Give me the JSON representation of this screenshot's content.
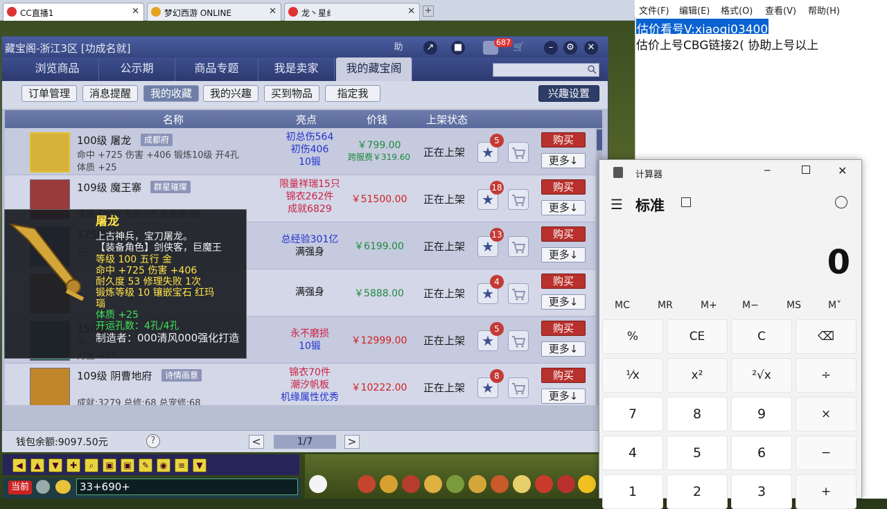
{
  "browser": {
    "tabs": [
      {
        "label": "CC直播1",
        "close": "✕"
      },
      {
        "label": "梦幻西游 ONLINE",
        "close": "✕"
      },
      {
        "label": "龙丶星纟",
        "close": "✕"
      }
    ],
    "new_tab": "+"
  },
  "cbg": {
    "title": "藏宝阁-浙江3区 [功成名就]",
    "title_buttons": {
      "help": "助",
      "share": "↗",
      "stop": "■",
      "msg_count": "687",
      "cart": "🛒",
      "minimize": "–",
      "settings": "⚙",
      "close": "✕"
    },
    "nav_tabs": [
      "浏览商品",
      "公示期",
      "商品专题",
      "我是卖家",
      "我的藏宝阁"
    ],
    "sub_buttons": [
      "订单管理",
      "消息提醒",
      "我的收藏",
      "我的兴趣",
      "买到物品",
      "指定我"
    ],
    "interest_settings": "兴趣设置",
    "columns": {
      "name": "名称",
      "highlight": "亮点",
      "price": "价钱",
      "status": "上架状态"
    },
    "rows": [
      {
        "level_name": "100级  屠龙",
        "server": "成都府",
        "stats1": "命中 +725  伤害 +406  锻炼10级  开4孔",
        "stats2": "体质 +25",
        "hl": [
          "初总伤564",
          "初伤406",
          "10锻"
        ],
        "hl_colors": [
          "#2233cc",
          "#2233cc",
          "#2233cc"
        ],
        "price": "￥799.00",
        "price2": "跨服费￥319.60",
        "price_color": "#1f8a3a",
        "status": "正在上架",
        "fav": "5",
        "buy": "购买",
        "more": "更多↓"
      },
      {
        "level_name": "109级  魔王寨",
        "server": "群星璀璨",
        "stats1": "",
        "stats2": "成就:6829  总修:68  总宠修:68",
        "hl": [
          "限量祥瑞15只",
          "锦衣262件",
          "成就6829"
        ],
        "hl_colors": [
          "#cc2244",
          "#cc2244",
          "#cc2244"
        ],
        "price": "￥51500.00",
        "price2": "",
        "price_color": "#d01f1f",
        "status": "正在上架",
        "fav": "18",
        "buy": "购买",
        "more": "更多↓"
      },
      {
        "level_name": "175级",
        "server": "",
        "stats1": "已",
        "stats2": "",
        "hl": [
          "总经验301亿",
          "满强身"
        ],
        "hl_colors": [
          "#2233cc",
          "#111111"
        ],
        "price": "￥6199.00",
        "price2": "",
        "price_color": "#1f8a3a",
        "status": "正在上架",
        "fav": "13",
        "buy": "购买",
        "more": "更多↓"
      },
      {
        "level_name": "",
        "server": "",
        "stats1": "",
        "stats2": "",
        "hl": [
          "满强身"
        ],
        "hl_colors": [
          "#111111"
        ],
        "price": "￥5888.00",
        "price2": "",
        "price_color": "#1f8a3a",
        "status": "正在上架",
        "fav": "4",
        "buy": "购买",
        "more": "更多↓"
      },
      {
        "level_name": "150级",
        "server": "",
        "stats1": "伤",
        "stats2": "力量 +18",
        "hl": [
          "永不磨损",
          "10锻"
        ],
        "hl_colors": [
          "#cc2244",
          "#2233cc"
        ],
        "price": "￥12999.00",
        "price2": "",
        "price_color": "#d01f1f",
        "status": "正在上架",
        "fav": "5",
        "buy": "购买",
        "more": "更多↓"
      },
      {
        "level_name": "109级  阴曹地府",
        "server": "诗情画意",
        "stats1": "",
        "stats2": "成就:3279  总修:68  总宠修:68",
        "hl": [
          "锦衣70件",
          "潮汐帆板",
          "机缘属性优秀"
        ],
        "hl_colors": [
          "#cc2244",
          "#cc2244",
          "#2233cc"
        ],
        "price": "￥10222.00",
        "price2": "",
        "price_color": "#d01f1f",
        "status": "正在上架",
        "fav": "8",
        "buy": "购买",
        "more": "更多↓"
      }
    ],
    "wallet": "钱包余额:9097.50元",
    "help": "?",
    "page": "1/7",
    "prev": "<",
    "next": ">"
  },
  "tooltip": {
    "name": "屠龙",
    "desc": "上古神兵，宝刀屠龙。",
    "role": "【装备角色】剑侠客，巨魔王",
    "l1": "等级 100  五行 金",
    "l2": "命中 +725  伤害 +406",
    "l3": "耐久度 53  修理失败 1次",
    "l4": "锻炼等级 10  镶嵌宝石 红玛",
    "l5": "瑙",
    "l6": "体质 +25",
    "l7": "开运孔数：4孔/4孔",
    "maker": "制造者：000清风000强化打造"
  },
  "game": {
    "chat_mode": "当前",
    "chat_text": "33+690+"
  },
  "notepad": {
    "menu": [
      "文件(F)",
      "编辑(E)",
      "格式(O)",
      "查看(V)",
      "帮助(H)"
    ],
    "line1": "估价看号V:xiaoqi03400",
    "line2": "估价上号CBG链接2( 协助上号以上"
  },
  "calculator": {
    "title": "计算器",
    "mode": "标准",
    "display": "0",
    "memory": [
      "MC",
      "MR",
      "M+",
      "M−",
      "MS",
      "M˅"
    ],
    "keys": [
      "%",
      "CE",
      "C",
      "⌫",
      "⅟x",
      "x²",
      "²√x",
      "÷",
      "7",
      "8",
      "9",
      "×",
      "4",
      "5",
      "6",
      "−",
      "1",
      "2",
      "3",
      "+"
    ]
  },
  "colors": {
    "cbg_title": "#35457f",
    "buy_red": "#b8312d",
    "accent_blue": "#0a62d0"
  }
}
